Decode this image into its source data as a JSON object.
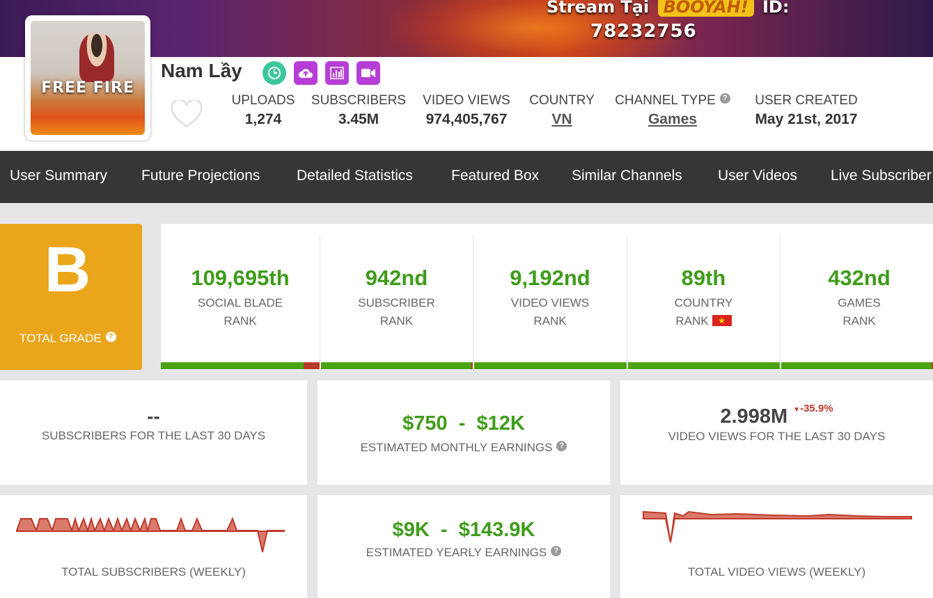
{
  "banner": {
    "text_prefix": "Stream Tại",
    "brand": "BOOYAH!",
    "text_suffix": "ID:",
    "stream_id": "78232756"
  },
  "channel": {
    "name": "Nam Lầy",
    "avatar_text": "FREE FIRE",
    "icons": [
      "clock-icon",
      "upload-icon",
      "bar-chart-icon",
      "video-camera-icon"
    ]
  },
  "stats": {
    "uploads": {
      "label": "UPLOADS",
      "value": "1,274"
    },
    "subscribers": {
      "label": "SUBSCRIBERS",
      "value": "3.45M"
    },
    "video_views": {
      "label": "VIDEO VIEWS",
      "value": "974,405,767"
    },
    "country": {
      "label": "COUNTRY",
      "value": "VN"
    },
    "channel_type": {
      "label": "CHANNEL TYPE",
      "value": "Games"
    },
    "user_created": {
      "label": "USER CREATED",
      "value": "May 21st, 2017"
    }
  },
  "nav": {
    "items": [
      "User Summary",
      "Future Projections",
      "Detailed Statistics",
      "Featured Box",
      "Similar Channels",
      "User Videos",
      "Live Subscriber"
    ]
  },
  "grade": {
    "letter": "B",
    "label": "TOTAL GRADE",
    "color": "#eba51a"
  },
  "ranks": [
    {
      "value": "109,695th",
      "line1": "SOCIAL BLADE",
      "line2": "RANK",
      "progress": 0.9
    },
    {
      "value": "942nd",
      "line1": "SUBSCRIBER",
      "line2": "RANK",
      "progress": 0.99
    },
    {
      "value": "9,192nd",
      "line1": "VIDEO VIEWS",
      "line2": "RANK",
      "progress": 1.0
    },
    {
      "value": "89th",
      "line1": "COUNTRY",
      "line2": "RANK",
      "progress": 1.0
    },
    {
      "value": "432nd",
      "line1": "GAMES",
      "line2": "RANK",
      "progress": 0.99
    }
  ],
  "cards": {
    "subs30": {
      "value": "--",
      "label": "SUBSCRIBERS FOR THE LAST 30 DAYS"
    },
    "monthly": {
      "low": "$750",
      "sep": "-",
      "high": "$12K",
      "label": "ESTIMATED MONTHLY EARNINGS"
    },
    "views30": {
      "value": "2.998M",
      "change": "-35.9%",
      "label": "VIDEO VIEWS FOR THE LAST 30 DAYS"
    },
    "total_subs": {
      "label": "TOTAL SUBSCRIBERS (WEEKLY)"
    },
    "yearly": {
      "low": "$9K",
      "sep": "-",
      "high": "$143.9K",
      "label": "ESTIMATED YEARLY EARNINGS"
    },
    "total_views": {
      "label": "TOTAL VIDEO VIEWS (WEEKLY)"
    }
  },
  "colors": {
    "accent_green": "#3e9c1a",
    "nav_bg": "#363636",
    "spark": "#c0392b"
  }
}
